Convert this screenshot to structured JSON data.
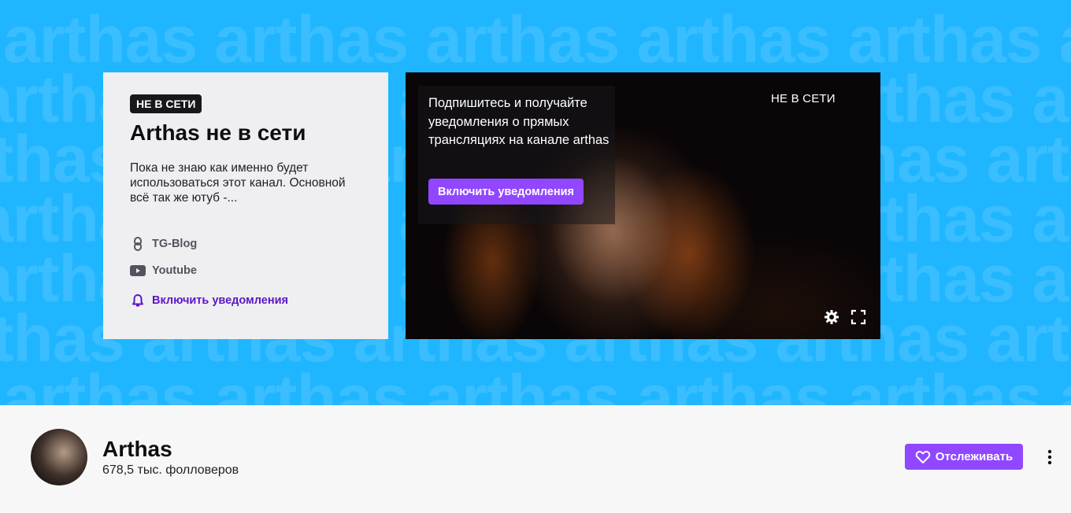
{
  "banner": {
    "background_word": "arthas",
    "background_color": "#1fb6ff"
  },
  "offline_card": {
    "badge": "НЕ В СЕТИ",
    "title": "Arthas не в сети",
    "description": "Пока не знаю как именно будет использоваться этот канал. Основной всё так же ютуб -...",
    "links": [
      {
        "label": "TG-Blog",
        "icon": "link-icon"
      },
      {
        "label": "Youtube",
        "icon": "youtube-icon"
      }
    ],
    "notify_label": "Включить уведомления"
  },
  "video": {
    "subscribe_text": "Подпишитесь и получайте уведомления о прямых трансляциях на канале arthas",
    "subscribe_button": "Включить уведомления",
    "status": "НЕ В СЕТИ",
    "controls": [
      "gear-icon",
      "fullscreen-icon"
    ]
  },
  "profile": {
    "name": "Arthas",
    "followers": "678,5 тыс. фолловеров",
    "follow_button": "Отслеживать",
    "accent_color": "#9147ff"
  }
}
